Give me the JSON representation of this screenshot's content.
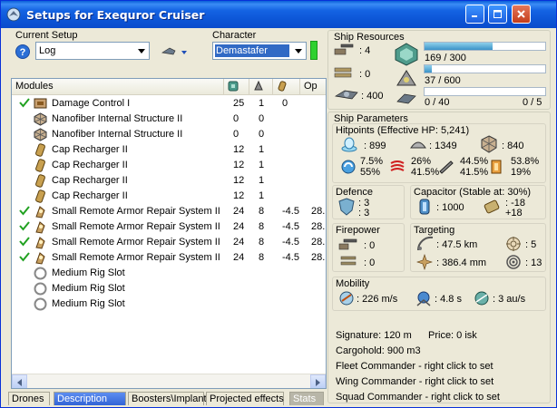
{
  "window": {
    "title": "Setups for Exequror Cruiser"
  },
  "setup": {
    "label": "Current Setup",
    "value": "Log"
  },
  "character": {
    "label": "Character",
    "value": "Demastafer"
  },
  "modules": {
    "headers": [
      "Modules",
      "",
      "",
      "",
      "Op"
    ],
    "rows": [
      {
        "checked": true,
        "icon": "damage-control-icon",
        "name": "Damage Control I",
        "c1": "25",
        "c2": "1",
        "c3": "0",
        "c4": ""
      },
      {
        "checked": false,
        "icon": "nanofiber-icon",
        "name": "Nanofiber Internal Structure II",
        "c1": "0",
        "c2": "0",
        "c3": "",
        "c4": ""
      },
      {
        "checked": false,
        "icon": "nanofiber-icon",
        "name": "Nanofiber Internal Structure II",
        "c1": "0",
        "c2": "0",
        "c3": "",
        "c4": ""
      },
      {
        "checked": false,
        "icon": "cap-recharger-icon",
        "name": "Cap Recharger II",
        "c1": "12",
        "c2": "1",
        "c3": "",
        "c4": ""
      },
      {
        "checked": false,
        "icon": "cap-recharger-icon",
        "name": "Cap Recharger II",
        "c1": "12",
        "c2": "1",
        "c3": "",
        "c4": ""
      },
      {
        "checked": false,
        "icon": "cap-recharger-icon",
        "name": "Cap Recharger II",
        "c1": "12",
        "c2": "1",
        "c3": "",
        "c4": ""
      },
      {
        "checked": false,
        "icon": "cap-recharger-icon",
        "name": "Cap Recharger II",
        "c1": "12",
        "c2": "1",
        "c3": "",
        "c4": ""
      },
      {
        "checked": true,
        "icon": "remote-armor-repair-icon",
        "name": "Small Remote Armor Repair System II",
        "c1": "24",
        "c2": "8",
        "c3": "-4.5",
        "c4": "28."
      },
      {
        "checked": true,
        "icon": "remote-armor-repair-icon",
        "name": "Small Remote Armor Repair System II",
        "c1": "24",
        "c2": "8",
        "c3": "-4.5",
        "c4": "28."
      },
      {
        "checked": true,
        "icon": "remote-armor-repair-icon",
        "name": "Small Remote Armor Repair System II",
        "c1": "24",
        "c2": "8",
        "c3": "-4.5",
        "c4": "28."
      },
      {
        "checked": true,
        "icon": "remote-armor-repair-icon",
        "name": "Small Remote Armor Repair System II",
        "c1": "24",
        "c2": "8",
        "c3": "-4.5",
        "c4": "28."
      },
      {
        "checked": false,
        "icon": "rig-slot-icon",
        "name": "Medium Rig Slot",
        "c1": "",
        "c2": "",
        "c3": "",
        "c4": ""
      },
      {
        "checked": false,
        "icon": "rig-slot-icon",
        "name": "Medium Rig Slot",
        "c1": "",
        "c2": "",
        "c3": "",
        "c4": ""
      },
      {
        "checked": false,
        "icon": "rig-slot-icon",
        "name": "Medium Rig Slot",
        "c1": "",
        "c2": "",
        "c3": "",
        "c4": ""
      }
    ]
  },
  "tabs": [
    "Drones",
    "Description",
    "Boosters\\Implants",
    "Projected effects",
    "Stats"
  ],
  "resources": {
    "label": "Ship Resources",
    "turret_hardpoints": ": 4",
    "launcher_hardpoints": ": 0",
    "drone_bandwidth": ": 400",
    "cpu_text": "169 / 300",
    "cpu_ratio": 0.563,
    "powergrid_text": "37 / 600",
    "powergrid_ratio": 0.062,
    "drone_bay_text": "0 / 40",
    "drone_bay_ratio": 0.0,
    "calibration_text": "0 / 5"
  },
  "params": {
    "label": "Ship Parameters",
    "hitpoints_label": "Hitpoints (Effective HP: 5,241)",
    "shield_hp": ": 899",
    "armor_hp": ": 1349",
    "structure_hp": ": 840",
    "res_shield_top": "7.5%",
    "res_shield_bottom": "55%",
    "res_armor_top": "26%",
    "res_armor_bottom": "41.5%",
    "res_kin_top": "44.5%",
    "res_kin_bottom": "41.5%",
    "res_exp_top": "53.8%",
    "res_exp_bottom": "19%",
    "defence_label": "Defence",
    "defence_top": ": 3",
    "defence_bottom": ": 3",
    "capacitor_label": "Capacitor (Stable at: 30%)",
    "capacitor_amount": ": 1000",
    "cap_delta_top": ": -18",
    "cap_delta_bottom": "+18",
    "firepower_label": "Firepower",
    "firepower_top": ": 0",
    "firepower_bottom": ": 0",
    "targeting_label": "Targeting",
    "target_range": ": 47.5 km",
    "max_targets": ": 5",
    "scan_res": ": 386.4 mm",
    "sensor_strength": ": 13",
    "mobility_label": "Mobility",
    "velocity": ": 226 m/s",
    "align_time": ": 4.8 s",
    "warp_speed": ": 3 au/s",
    "signature": "Signature: 120 m",
    "price": "Price: 0 isk",
    "cargohold": "Cargohold: 900 m3",
    "fleet": "Fleet Commander - right click to set",
    "wing": "Wing Commander - right click to set",
    "squad": "Squad Commander - right click to set"
  },
  "colors": {
    "title_bar": "#0a5fd8",
    "selection": "#316ac5",
    "bar_fill": "#3a92c8",
    "check": "#21a121"
  }
}
